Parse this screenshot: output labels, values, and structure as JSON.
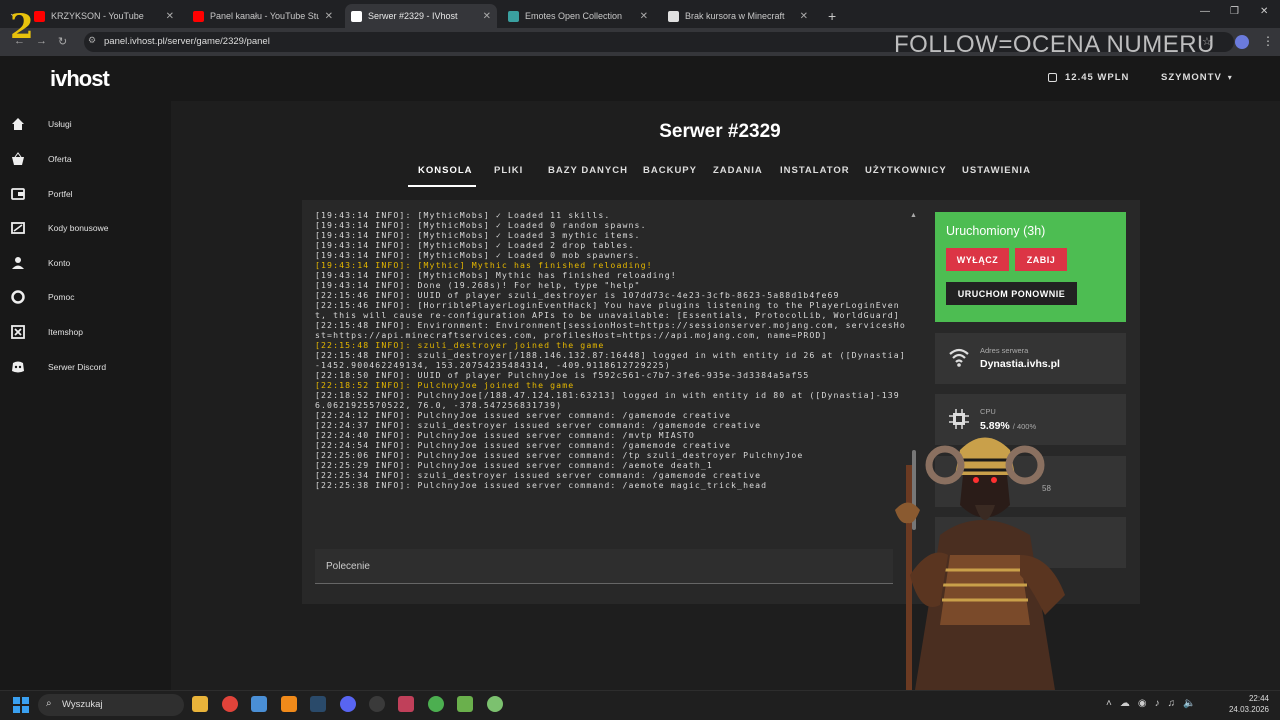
{
  "browser": {
    "tabs": [
      {
        "title": "KRZYKSON - YouTube",
        "favicon_color": "#ff0000"
      },
      {
        "title": "Panel kanału - YouTube Studio",
        "favicon_color": "#ff0000"
      },
      {
        "title": "Serwer #2329 - IVhost",
        "favicon_color": "#ffffff"
      },
      {
        "title": "Emotes Open Collection",
        "favicon_color": "#3aa0a0"
      },
      {
        "title": "Brak kursora w Minecraft",
        "favicon_color": "#e0e0e0"
      }
    ],
    "active_tab": 2,
    "new_tab": "+",
    "url": "panel.ivhost.pl/server/game/2329/panel"
  },
  "overlay": {
    "follow_text": "FOLLOW=OCENA NUMERU",
    "number": "2"
  },
  "site": {
    "logo": "ivhost",
    "wallet": "12.45 WPLN",
    "user": "SZYMONTV",
    "sidebar": [
      {
        "label": "Usługi",
        "icon": "home-icon"
      },
      {
        "label": "Oferta",
        "icon": "basket-icon"
      },
      {
        "label": "Portfel",
        "icon": "wallet-icon"
      },
      {
        "label": "Kody bonusowe",
        "icon": "ticket-icon"
      },
      {
        "label": "Konto",
        "icon": "user-icon"
      },
      {
        "label": "Pomoc",
        "icon": "lifebuoy-icon"
      },
      {
        "label": "Itemshop",
        "icon": "shop-icon"
      },
      {
        "label": "Serwer Discord",
        "icon": "discord-icon"
      }
    ],
    "title": "Serwer #2329",
    "tabs": [
      "KONSOLA",
      "PLIKI",
      "BAZY DANYCH",
      "BACKUPY",
      "ZADANIA",
      "INSTALATOR",
      "UŻYTKOWNICY",
      "USTAWIENIA"
    ],
    "active_tab": "KONSOLA"
  },
  "console": {
    "lines": [
      {
        "t": "[19:43:14 INFO]: [MythicMobs] ✓ Loaded 11 skills.",
        "c": ""
      },
      {
        "t": "[19:43:14 INFO]: [MythicMobs] ✓ Loaded 0 random spawns.",
        "c": ""
      },
      {
        "t": "[19:43:14 INFO]: [MythicMobs] ✓ Loaded 3 mythic items.",
        "c": ""
      },
      {
        "t": "[19:43:14 INFO]: [MythicMobs] ✓ Loaded 2 drop tables.",
        "c": ""
      },
      {
        "t": "[19:43:14 INFO]: [MythicMobs] ✓ Loaded 0 mob spawners.",
        "c": ""
      },
      {
        "t": "[19:43:14 INFO]: [Mythic] Mythic has finished reloading!",
        "c": "y"
      },
      {
        "t": "[19:43:14 INFO]: [MythicMobs] Mythic has finished reloading!",
        "c": ""
      },
      {
        "t": "[19:43:14 INFO]: Done (19.268s)! For help, type \"help\"",
        "c": ""
      },
      {
        "t": "[22:15:46 INFO]: UUID of player szuli_destroyer is 107dd73c-4e23-3cfb-8623-5a88d1b4fe69",
        "c": ""
      },
      {
        "t": "[22:15:46 INFO]: [HorriblePlayerLoginEventHack] You have plugins listening to the PlayerLoginEvent, this will cause re-configuration APIs to be unavailable: [Essentials, ProtocolLib, WorldGuard]",
        "c": ""
      },
      {
        "t": "[22:15:48 INFO]: Environment: Environment[sessionHost=https://sessionserver.mojang.com, servicesHost=https://api.minecraftservices.com, profilesHost=https://api.mojang.com, name=PROD]",
        "c": ""
      },
      {
        "t": "[22:15:48 INFO]: szuli_destroyer joined the game",
        "c": "y"
      },
      {
        "t": "[22:15:48 INFO]: szuli_destroyer[/188.146.132.87:16448] logged in with entity id 26 at ([Dynastia]-1452.900462249134, 153.20754235484314, -409.9118612729225)",
        "c": ""
      },
      {
        "t": "[22:18:50 INFO]: UUID of player PulchnyJoe is f592c561-c7b7-3fe6-935e-3d3384a5af55",
        "c": ""
      },
      {
        "t": "[22:18:52 INFO]: PulchnyJoe joined the game",
        "c": "y"
      },
      {
        "t": "[22:18:52 INFO]: PulchnyJoe[/188.47.124.181:63213] logged in with entity id 80 at ([Dynastia]-1396.0621925570522, 76.0, -378.547256831739)",
        "c": ""
      },
      {
        "t": "[22:24:12 INFO]: PulchnyJoe issued server command: /gamemode creative",
        "c": ""
      },
      {
        "t": "[22:24:37 INFO]: szuli_destroyer issued server command: /gamemode creative",
        "c": ""
      },
      {
        "t": "[22:24:40 INFO]: PulchnyJoe issued server command: /mvtp MIASTO",
        "c": ""
      },
      {
        "t": "[22:24:54 INFO]: PulchnyJoe issued server command: /gamemode creative",
        "c": ""
      },
      {
        "t": "[22:25:06 INFO]: PulchnyJoe issued server command: /tp szuli_destroyer PulchnyJoe",
        "c": ""
      },
      {
        "t": "[22:25:29 INFO]: PulchnyJoe issued server command: /aemote death_1",
        "c": ""
      },
      {
        "t": "[22:25:34 INFO]: szuli_destroyer issued server command: /gamemode creative",
        "c": ""
      },
      {
        "t": "[22:25:38 INFO]: PulchnyJoe issued server command: /aemote magic_trick_head",
        "c": ""
      }
    ],
    "command_placeholder": "Polecenie"
  },
  "status": {
    "text": "Uruchomiony (3h)",
    "btn_stop": "WYŁĄCZ",
    "btn_kill": "ZABIJ",
    "btn_restart": "URUCHOM PONOWNIE",
    "color": "#4dbd52"
  },
  "cards": {
    "address_label": "Adres serwera",
    "address_value": "Dynastia.ivhs.pl",
    "cpu_label": "CPU",
    "cpu_value": "5.89%",
    "cpu_max": "/ 400%",
    "partial_text": "58"
  },
  "taskbar": {
    "search": "Wyszukaj",
    "time": "22:44",
    "date": "24.03.2026"
  }
}
